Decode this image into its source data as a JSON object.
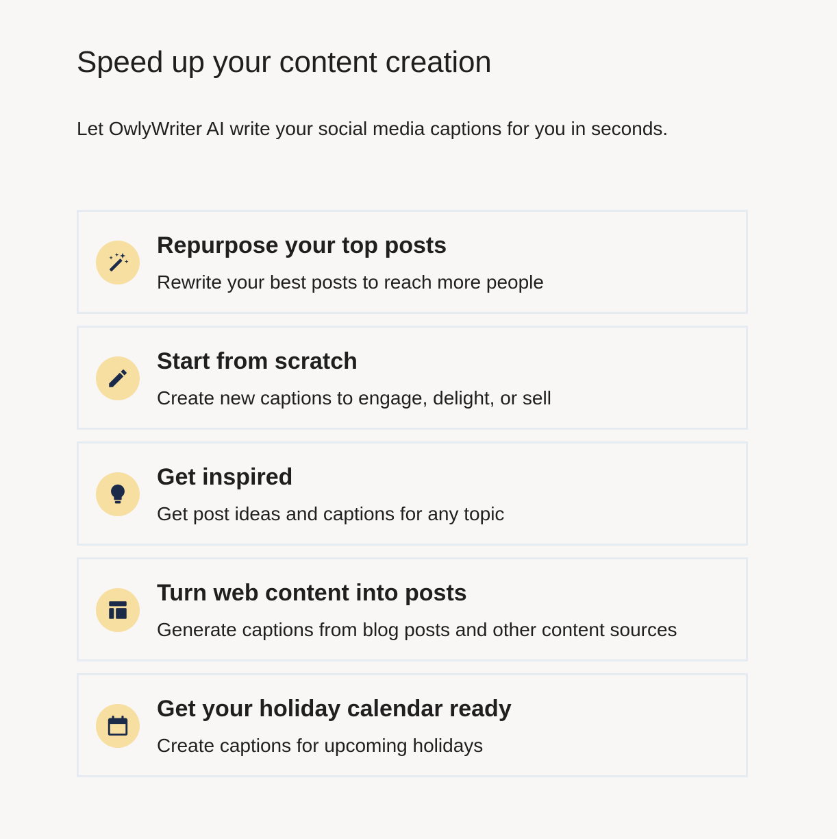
{
  "header": {
    "title": "Speed up your content creation",
    "subtitle": "Let OwlyWriter AI write your social media captions for you in seconds."
  },
  "colors": {
    "background": "#f8f7f5",
    "card_border": "#e6ebf2",
    "icon_circle": "#f7dea1",
    "icon_fill": "#1b2a48",
    "text": "#1f1f1f"
  },
  "options": [
    {
      "icon": "magic-wand-icon",
      "title": "Repurpose your top posts",
      "description": "Rewrite your best posts to reach more people"
    },
    {
      "icon": "pencil-icon",
      "title": "Start from scratch",
      "description": "Create new captions to engage, delight, or sell"
    },
    {
      "icon": "lightbulb-icon",
      "title": "Get inspired",
      "description": "Get post ideas and captions for any topic"
    },
    {
      "icon": "layout-icon",
      "title": "Turn web content into posts",
      "description": "Generate captions from blog posts and other content sources"
    },
    {
      "icon": "calendar-icon",
      "title": "Get your holiday calendar ready",
      "description": "Create captions for upcoming holidays"
    }
  ]
}
